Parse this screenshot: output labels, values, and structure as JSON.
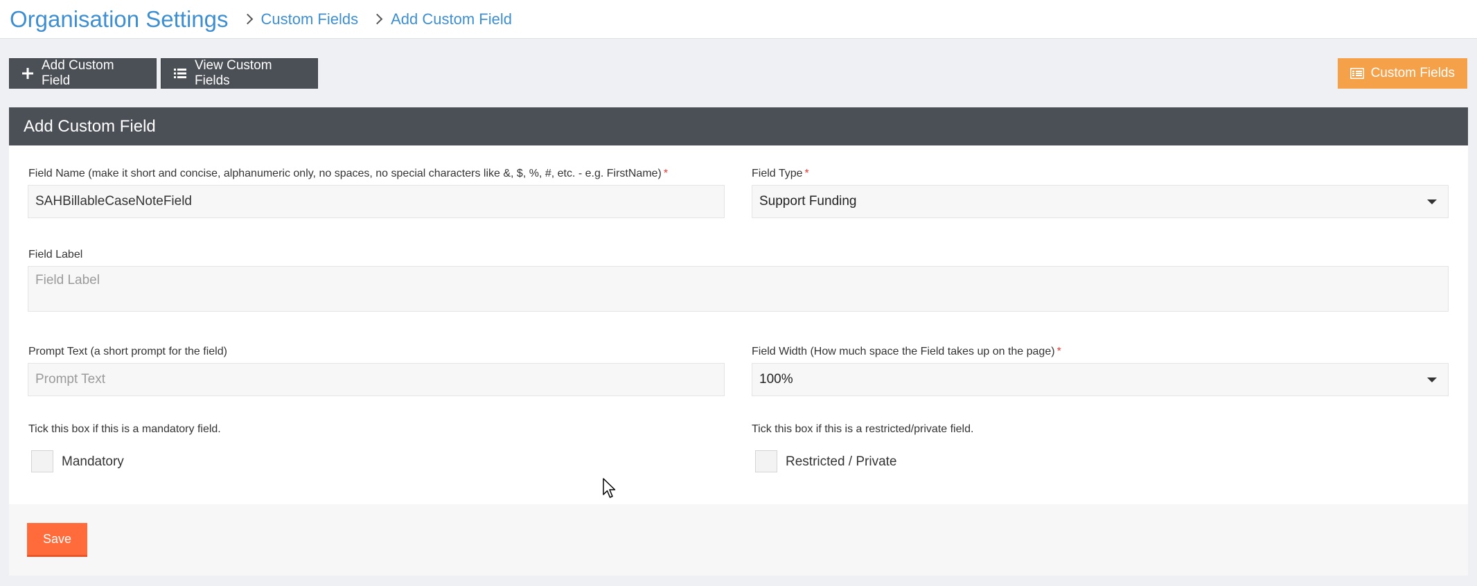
{
  "header": {
    "title": "Organisation Settings",
    "breadcrumbs": [
      "Custom Fields",
      "Add Custom Field"
    ]
  },
  "toolbar": {
    "add_label": "Add Custom Field",
    "view_label": "View Custom Fields",
    "custom_fields_label": "Custom Fields"
  },
  "panel": {
    "title": "Add Custom Field"
  },
  "form": {
    "field_name": {
      "label": "Field Name (make it short and concise, alphanumeric only, no spaces, no special characters like &, $, %, #, etc. - e.g. FirstName)",
      "required_mark": "*",
      "value": "SAHBillableCaseNoteField"
    },
    "field_type": {
      "label": "Field Type",
      "required_mark": "*",
      "selected": "Support Funding"
    },
    "field_label": {
      "label": "Field Label",
      "placeholder": "Field Label"
    },
    "prompt_text": {
      "label": "Prompt Text (a short prompt for the field)",
      "placeholder": "Prompt Text"
    },
    "field_width": {
      "label": "Field Width (How much space the Field takes up on the page)",
      "required_mark": "*",
      "selected": "100%"
    },
    "mandatory": {
      "hint": "Tick this box if this is a mandatory field.",
      "label": "Mandatory"
    },
    "restricted": {
      "hint": "Tick this box if this is a restricted/private field.",
      "label": "Restricted / Private"
    }
  },
  "footer": {
    "save_label": "Save"
  },
  "colors": {
    "link": "#3d8fd1",
    "dark": "#4b4f56",
    "orange": "#f5a14a",
    "save": "#ff6b3a",
    "required": "#e53935"
  }
}
